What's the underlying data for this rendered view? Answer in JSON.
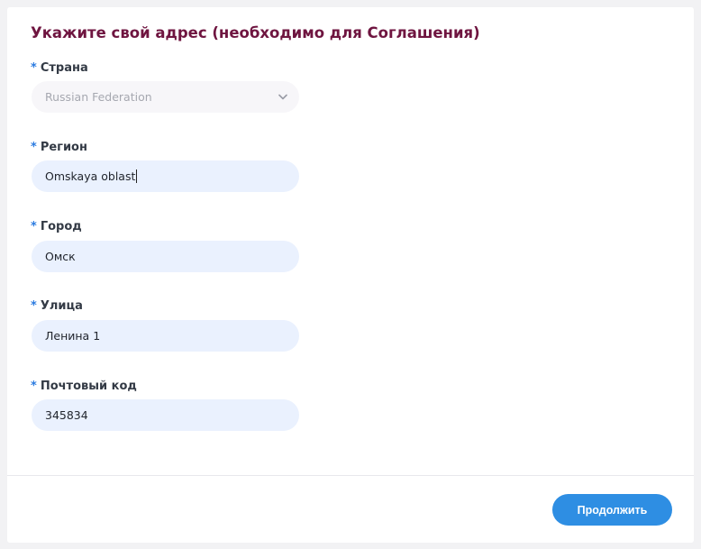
{
  "form": {
    "title": "Укажите свой адрес (необходимо для Соглашения)",
    "required_mark": "*",
    "fields": {
      "country": {
        "label": "Страна",
        "value": "Russian Federation"
      },
      "region": {
        "label": "Регион",
        "value": "Omskaya oblast"
      },
      "city": {
        "label": "Город",
        "value": "Омск"
      },
      "street": {
        "label": "Улица",
        "value": "Ленина 1"
      },
      "postal": {
        "label": "Почтовый код",
        "value": "345834"
      }
    }
  },
  "footer": {
    "continue_label": "Продолжить"
  },
  "colors": {
    "title": "#6f1540",
    "required": "#2b7be0",
    "input_bg": "#eaf1fe",
    "button": "#2e8ee3"
  },
  "icons": {
    "country_dropdown": "chevron-down-icon"
  }
}
